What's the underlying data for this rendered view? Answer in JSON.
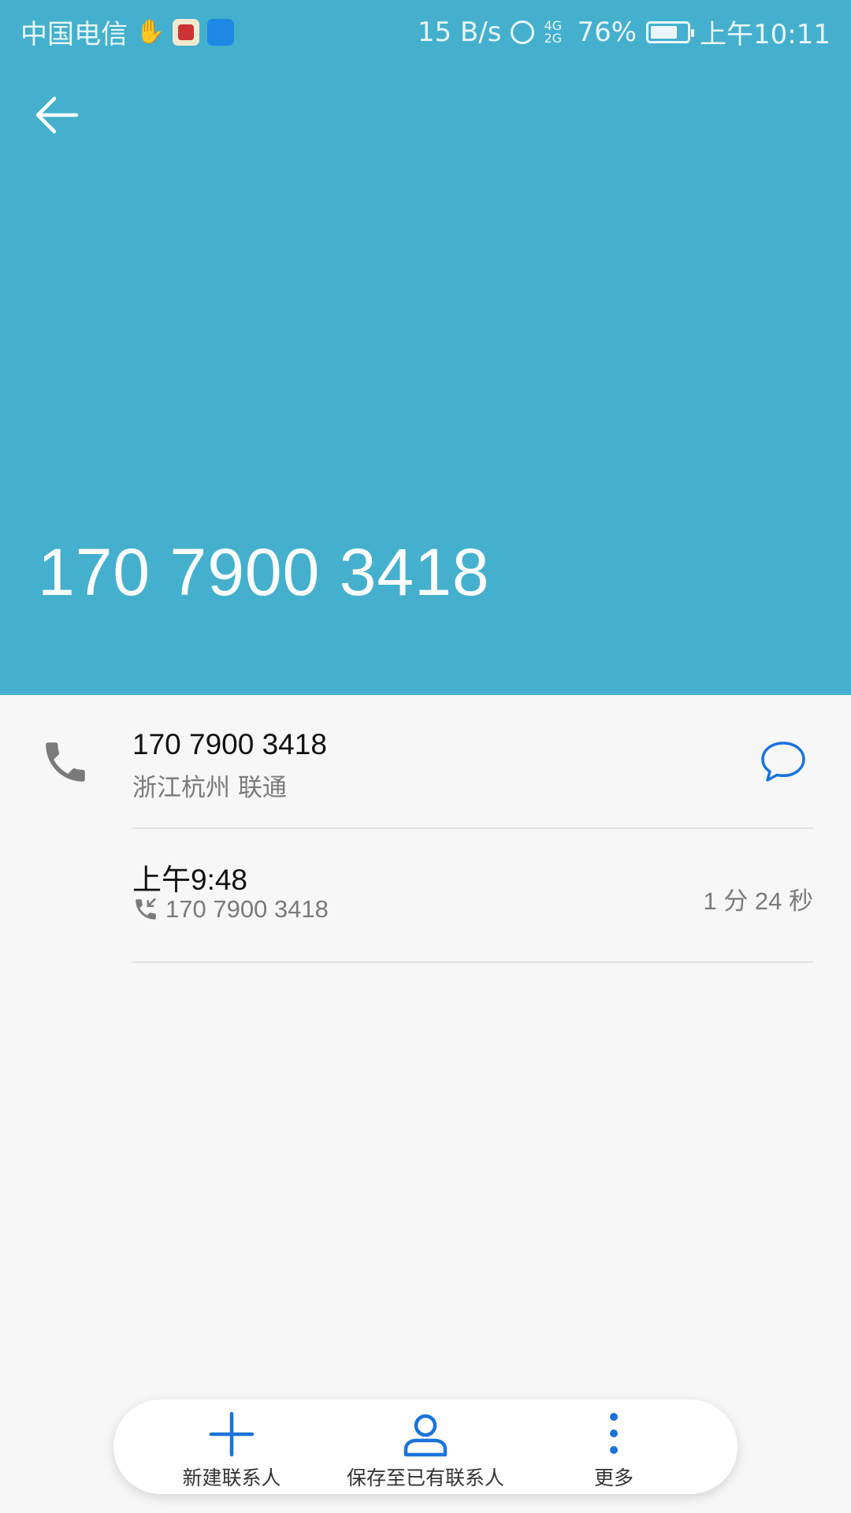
{
  "status_bar": {
    "carrier": "中国电信",
    "net_speed": "15 B/s",
    "battery": "76%",
    "battery_level": 0.76,
    "time": "上午10:11"
  },
  "header": {
    "phone_number": "170 7900 3418",
    "background_color": "#45b0cd"
  },
  "contact_row": {
    "number": "170 7900 3418",
    "location": "浙江杭州 联通"
  },
  "call_log": [
    {
      "time": "上午9:48",
      "number": "170 7900 3418",
      "duration": "1 分 24 秒"
    }
  ],
  "bottom_bar": {
    "new_contact": "新建联系人",
    "save_existing": "保存至已有联系人",
    "more": "更多"
  },
  "accent_color": "#1a73d9"
}
